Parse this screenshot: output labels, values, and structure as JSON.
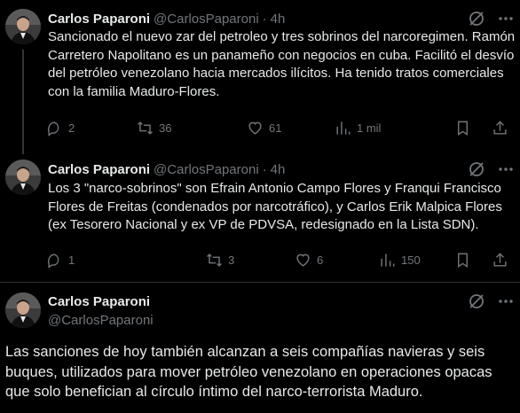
{
  "tweets": [
    {
      "name": "Carlos Paparoni",
      "handle": "@CarlosPaparoni",
      "dot": "·",
      "time": "4h",
      "text": "Sancionado el nuevo zar del petroleo y tres sobrinos del narcoregimen. Ramón Carretero Napolitano es un panameño con negocios en cuba. Facilitó el desvío del petróleo venezolano hacia mercados ilícitos. Ha tenido tratos comerciales con la familia Maduro-Flores.",
      "replies": "2",
      "reposts": "36",
      "likes": "61",
      "views": "1 mil"
    },
    {
      "name": "Carlos Paparoni",
      "handle": "@CarlosPaparoni",
      "dot": "·",
      "time": "4h",
      "text": "Los 3 \"narco-sobrinos\" son Efrain Antonio Campo Flores y Franqui Francisco Flores de Freitas (condenados por narcotráfico), y Carlos Erik Malpica Flores (ex Tesorero Nacional y ex VP de PDVSA, redesignado en la Lista SDN).",
      "replies": "1",
      "reposts": "3",
      "likes": "6",
      "views": "150"
    },
    {
      "name": "Carlos Paparoni",
      "handle": "@CarlosPaparoni",
      "text": "Las sanciones de hoy también alcanzan a seis compañías navieras y seis buques, utilizados para mover petróleo venezolano en operaciones opacas que solo benefician al círculo íntimo del narco-terrorista Maduro."
    }
  ],
  "icons": {
    "reply": "reply-icon",
    "repost": "repost-icon",
    "like": "heart-icon",
    "views": "views-icon",
    "bookmark": "bookmark-icon",
    "share": "share-icon",
    "grok": "grok-icon",
    "more": "more-icon"
  },
  "colors": {
    "background": "#000000",
    "text": "#e7e9ea",
    "muted": "#71767b",
    "line": "#333639"
  }
}
